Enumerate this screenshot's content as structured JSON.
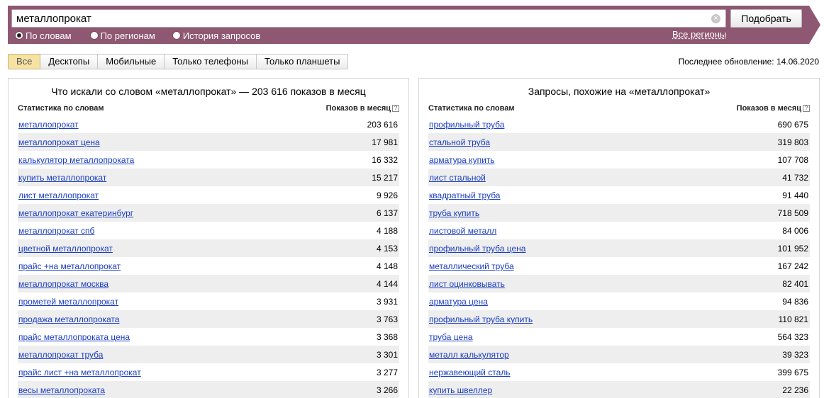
{
  "search": {
    "query": "металлопрокат",
    "clear_glyph": "×",
    "submit_label": "Подобрать",
    "modes": [
      {
        "label": "По словам",
        "checked": true
      },
      {
        "label": "По регионам",
        "checked": false
      },
      {
        "label": "История запросов",
        "checked": false
      }
    ],
    "region_link": "Все регионы"
  },
  "device_tabs": [
    {
      "label": "Все",
      "active": true
    },
    {
      "label": "Десктопы",
      "active": false
    },
    {
      "label": "Мобильные",
      "active": false
    },
    {
      "label": "Только телефоны",
      "active": false
    },
    {
      "label": "Только планшеты",
      "active": false
    }
  ],
  "last_update": "Последнее обновление: 14.06.2020",
  "colors": {
    "header_band": "#8f5872",
    "link": "#1a3dc1",
    "active_tab": "#f6e3a3",
    "row_stripe": "#eeeeee"
  },
  "left_panel": {
    "title": "Что искали со словом «металлопрокат» — 203 616 показов в месяц",
    "col_keyword": "Статистика по словам",
    "col_count": "Показов в месяц",
    "help_glyph": "?",
    "rows": [
      {
        "keyword": "металлопрокат",
        "count": "203 616"
      },
      {
        "keyword": "металлопрокат цена",
        "count": "17 981"
      },
      {
        "keyword": "калькулятор металлопроката",
        "count": "16 332"
      },
      {
        "keyword": "купить металлопрокат",
        "count": "15 217"
      },
      {
        "keyword": "лист металлопрокат",
        "count": "9 926"
      },
      {
        "keyword": "металлопрокат екатеринбург",
        "count": "6 137"
      },
      {
        "keyword": "металлопрокат спб",
        "count": "4 188"
      },
      {
        "keyword": "цветной металлопрокат",
        "count": "4 153"
      },
      {
        "keyword": "прайс +на металлопрокат",
        "count": "4 148"
      },
      {
        "keyword": "металлопрокат москва",
        "count": "4 144"
      },
      {
        "keyword": "прометей металлопрокат",
        "count": "3 931"
      },
      {
        "keyword": "продажа металлопроката",
        "count": "3 763"
      },
      {
        "keyword": "прайс металлопроката цена",
        "count": "3 368"
      },
      {
        "keyword": "металлопрокат труба",
        "count": "3 301"
      },
      {
        "keyword": "прайс лист +на металлопрокат",
        "count": "3 277"
      },
      {
        "keyword": "весы металлопроката",
        "count": "3 266"
      }
    ]
  },
  "right_panel": {
    "title": "Запросы, похожие на «металлопрокат»",
    "col_keyword": "Статистика по словам",
    "col_count": "Показов в месяц",
    "help_glyph": "?",
    "rows": [
      {
        "keyword": "профильный труба",
        "count": "690 675"
      },
      {
        "keyword": "стальной труба",
        "count": "319 803"
      },
      {
        "keyword": "арматура купить",
        "count": "107 708"
      },
      {
        "keyword": "лист стальной",
        "count": "41 732"
      },
      {
        "keyword": "квадратный труба",
        "count": "91 440"
      },
      {
        "keyword": "труба купить",
        "count": "718 509"
      },
      {
        "keyword": "листовой металл",
        "count": "84 006"
      },
      {
        "keyword": "профильный труба цена",
        "count": "101 952"
      },
      {
        "keyword": "металлический труба",
        "count": "167 242"
      },
      {
        "keyword": "лист оцинковывать",
        "count": "82 401"
      },
      {
        "keyword": "арматура цена",
        "count": "94 836"
      },
      {
        "keyword": "профильный труба купить",
        "count": "110 821"
      },
      {
        "keyword": "труба цена",
        "count": "564 323"
      },
      {
        "keyword": "металл калькулятор",
        "count": "39 323"
      },
      {
        "keyword": "нержавеющий сталь",
        "count": "399 675"
      },
      {
        "keyword": "купить швеллер",
        "count": "22 236"
      }
    ]
  }
}
